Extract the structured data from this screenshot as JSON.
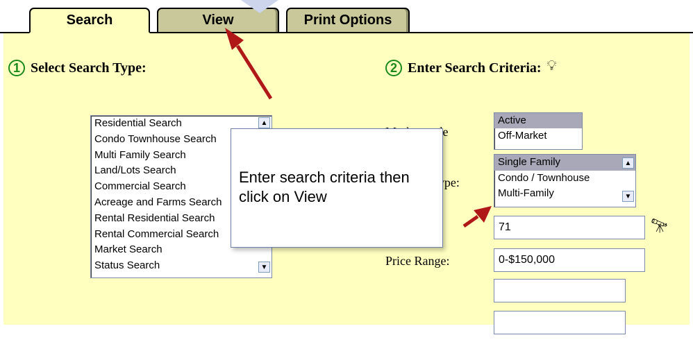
{
  "tabs": [
    {
      "label": "Search",
      "active": true
    },
    {
      "label": "View",
      "active": false
    },
    {
      "label": "Print Options",
      "active": false
    }
  ],
  "step1": {
    "number": "1",
    "title": "Select Search Type:"
  },
  "step2": {
    "number": "2",
    "title": "Enter Search Criteria:"
  },
  "search_types": [
    "Residential Search",
    "Condo Townhouse Search",
    "Multi Family Search",
    "Land/Lots Search",
    "Commercial Search",
    "Acreage and Farms Search",
    "Rental Residential Search",
    "Rental Commercial Search",
    "Market Search",
    "Status Search"
  ],
  "market_code": {
    "label": "Market code",
    "options": [
      "Active",
      "Off-Market"
    ],
    "selected": "Active"
  },
  "property_type": {
    "label": "Property Type:",
    "options": [
      "Single Family",
      "Condo / Townhouse",
      "Multi-Family"
    ],
    "selected": "Single Family"
  },
  "area": {
    "value": "71"
  },
  "price_range": {
    "label": "Price Range:",
    "value": "0-$150,000"
  },
  "extra_fields": [
    "",
    ""
  ],
  "tooltip": {
    "text": "Enter search criteria then click on View"
  },
  "colors": {
    "panel": "#ffffc0",
    "inactive_tab": "#c8c89a",
    "arrow": "#b01818",
    "step_circle": "#1a8a1a",
    "list_selected": "#a8a8b8"
  },
  "icons": [
    "lightbulb-icon",
    "binoculars-icon",
    "scroll-up-icon",
    "scroll-down-icon"
  ]
}
